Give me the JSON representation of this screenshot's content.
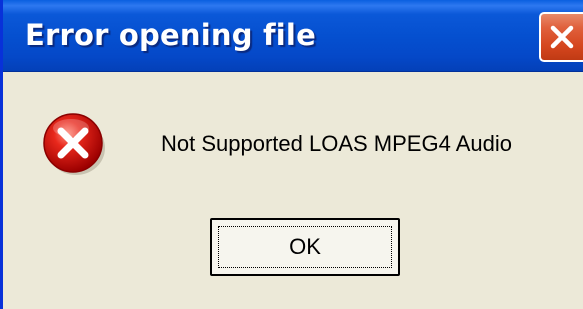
{
  "dialog": {
    "title": "Error opening file",
    "message": "Not Supported LOAS MPEG4 Audio",
    "icon": "error-icon",
    "close_icon": "close-icon",
    "ok_label": "OK"
  },
  "colors": {
    "titlebar": "#0550d0",
    "dialog_body": "#ece9d8",
    "close_button": "#d5461e",
    "error_icon": "#d40000"
  }
}
